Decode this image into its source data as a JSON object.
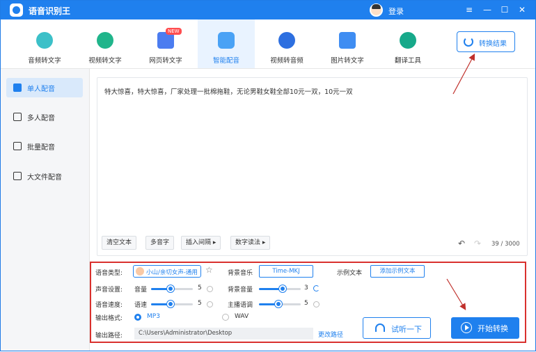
{
  "app": {
    "title": "语音识别王",
    "login": "登录"
  },
  "window_controls": {
    "menu": "≡",
    "minimize": "—",
    "maximize": "☐",
    "close": "✕"
  },
  "toolbar": {
    "items": [
      {
        "label": "音频转文字",
        "color": "#3cc0c8"
      },
      {
        "label": "视频转文字",
        "color": "#20b58b"
      },
      {
        "label": "网页转文字",
        "color": "#4b7cf0",
        "badge": "NEW"
      },
      {
        "label": "智能配音",
        "color": "#4aa2f5"
      },
      {
        "label": "视频转音频",
        "color": "#2d6fe0"
      },
      {
        "label": "图片转文字",
        "color": "#3f8df2"
      },
      {
        "label": "翻译工具",
        "color": "#17a98a"
      }
    ],
    "result_button": "转换结果"
  },
  "sidebar": {
    "items": [
      {
        "label": "单人配音",
        "icon": "single-voice-icon"
      },
      {
        "label": "多人配音",
        "icon": "multi-voice-icon"
      },
      {
        "label": "批量配音",
        "icon": "batch-voice-icon"
      },
      {
        "label": "大文件配音",
        "icon": "folder-icon"
      }
    ]
  },
  "editor": {
    "text": "特大惊喜，特大惊喜，厂家处理一批棉拖鞋，无论男鞋女鞋全部10元一双，10元一双",
    "buttons": [
      "清空文本",
      "多音字",
      "插入间隔 ▸",
      "数字读法 ▸"
    ],
    "counter": "39 / 3000"
  },
  "settings": {
    "voice_type_label": "语音类型:",
    "voice_name": "小山/亲切女声-通用",
    "bg_music_label": "背景音乐",
    "bg_music_value": "Time-MKJ",
    "sample_label": "示例文本",
    "sample_button": "添加示例文本",
    "sound_label": "声音设置:",
    "volume_label": "音量",
    "volume_value": "5",
    "bg_volume_label": "背景音量",
    "bg_volume_value": "3",
    "speed_label": "语音速度:",
    "rate_label": "语速",
    "rate_value": "5",
    "tone_label": "主播语调",
    "tone_value": "5",
    "format_label": "输出格式:",
    "format_mp3": "MP3",
    "format_wav": "WAV",
    "path_label": "输出路径:",
    "path_value": "C:\\Users\\Administrator\\Desktop",
    "change_path": "更改路径",
    "listen_button": "试听一下",
    "start_button": "开始转换"
  }
}
